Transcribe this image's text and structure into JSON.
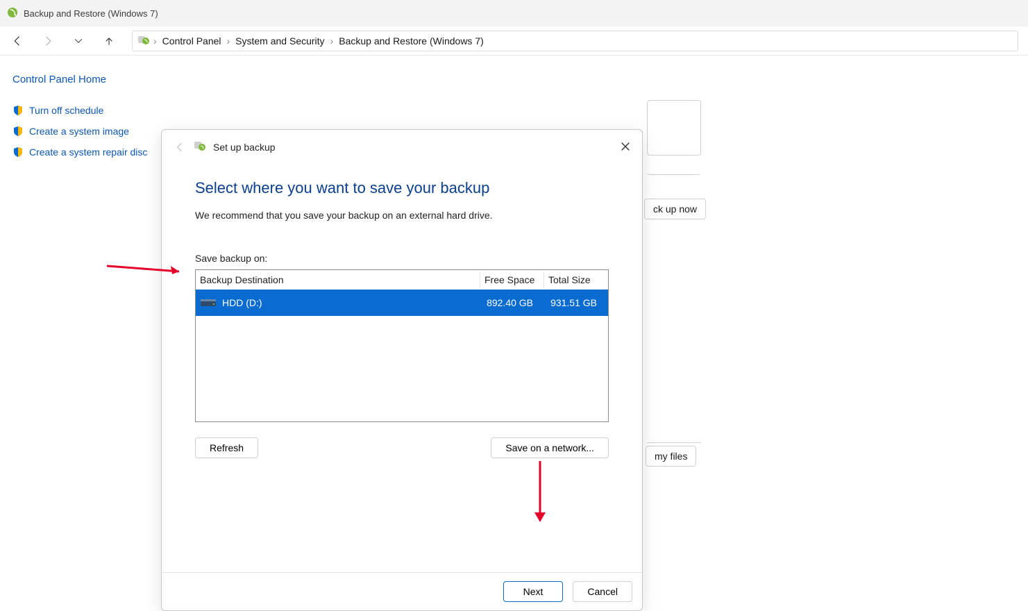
{
  "window": {
    "title": "Backup and Restore (Windows 7)"
  },
  "breadcrumb": {
    "items": [
      "Control Panel",
      "System and Security",
      "Backup and Restore (Windows 7)"
    ]
  },
  "sidebar": {
    "home": "Control Panel Home",
    "links": [
      "Turn off schedule",
      "Create a system image",
      "Create a system repair disc"
    ]
  },
  "background_buttons": {
    "backup_now": "ck up now",
    "my_files": "my files"
  },
  "dialog": {
    "top_title": "Set up backup",
    "heading": "Select where you want to save your backup",
    "subtext": "We recommend that you save your backup on an external hard drive.",
    "list_label": "Save backup on:",
    "table": {
      "columns": {
        "destination": "Backup Destination",
        "free": "Free Space",
        "total": "Total Size"
      },
      "rows": [
        {
          "name": "HDD (D:)",
          "free": "892.40 GB",
          "total": "931.51 GB"
        }
      ]
    },
    "buttons": {
      "refresh": "Refresh",
      "save_network": "Save on a network...",
      "next": "Next",
      "cancel": "Cancel"
    }
  }
}
